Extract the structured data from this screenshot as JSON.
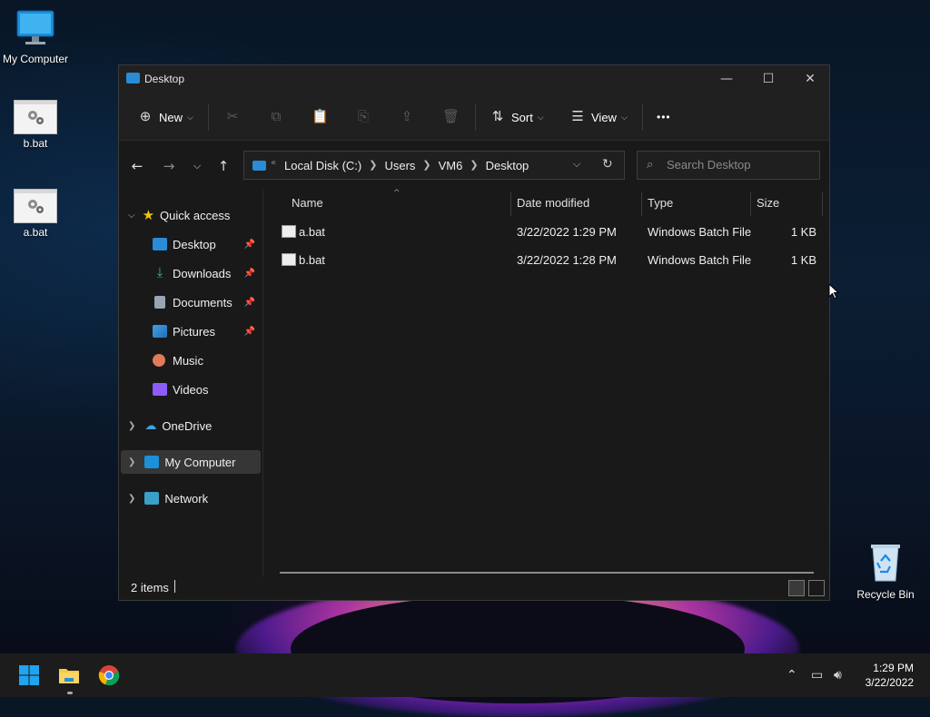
{
  "desktop": {
    "icons": [
      {
        "label": "My Computer"
      },
      {
        "label": "b.bat"
      },
      {
        "label": "a.bat"
      },
      {
        "label": "Recycle Bin"
      }
    ]
  },
  "window": {
    "title": "Desktop",
    "toolbar": {
      "new_label": "New",
      "sort_label": "Sort",
      "view_label": "View",
      "more_label": "•••"
    },
    "address": {
      "crumbs": [
        "Local Disk (C:)",
        "Users",
        "VM6",
        "Desktop"
      ],
      "overflow": "«"
    },
    "search": {
      "placeholder": "Search Desktop"
    },
    "sidebar": {
      "quick_access": "Quick access",
      "items": [
        {
          "label": "Desktop",
          "icon": "desktop-folder-icon",
          "color": "#2a8bd6"
        },
        {
          "label": "Downloads",
          "icon": "download-icon",
          "color": "#36b37e"
        },
        {
          "label": "Documents",
          "icon": "document-icon",
          "color": "#9aa4b5"
        },
        {
          "label": "Pictures",
          "icon": "pictures-icon",
          "color": "#3fa0e8"
        },
        {
          "label": "Music",
          "icon": "music-icon",
          "color": "#e07b5a"
        },
        {
          "label": "Videos",
          "icon": "videos-icon",
          "color": "#8b5cf6"
        }
      ],
      "onedrive": "OneDrive",
      "my_computer": "My Computer",
      "network": "Network"
    },
    "columns": {
      "name": "Name",
      "date": "Date modified",
      "type": "Type",
      "size": "Size"
    },
    "files": [
      {
        "name": "a.bat",
        "date": "3/22/2022 1:29 PM",
        "type": "Windows Batch File",
        "size": "1 KB"
      },
      {
        "name": "b.bat",
        "date": "3/22/2022 1:28 PM",
        "type": "Windows Batch File",
        "size": "1 KB"
      }
    ],
    "status": {
      "count": "2 items"
    }
  },
  "taskbar": {
    "time": "1:29 PM",
    "date": "3/22/2022"
  },
  "colors": {
    "accent": "#2a8bd6",
    "window_bg": "#191919",
    "taskbar_bg": "#1c1c1c"
  }
}
